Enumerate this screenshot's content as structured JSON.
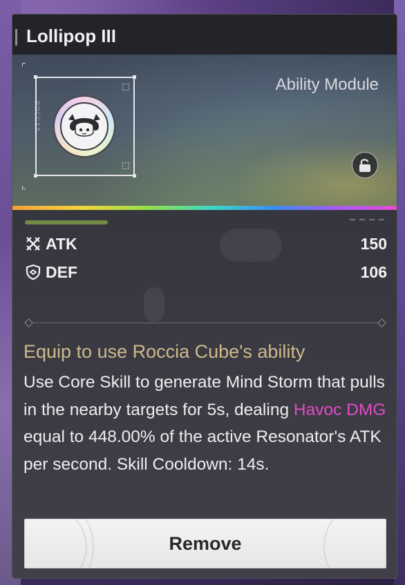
{
  "item": {
    "name": "Lollipop III",
    "type_label": "Ability Module",
    "side_code": "ROCCIA"
  },
  "stats": [
    {
      "name": "ATK",
      "value": "150",
      "icon": "crossed-swords-icon"
    },
    {
      "name": "DEF",
      "value": "106",
      "icon": "shield-icon"
    }
  ],
  "description": {
    "title": "Equip to use Roccia Cube's ability",
    "body_part1": "Use Core Skill to generate Mind Storm that pulls in the nearby targets for 5s, dealing ",
    "highlight": "Havoc DMG",
    "body_part2": " equal to 448.00% of the active Resonator's ATK per second. Skill Cooldown: 14s."
  },
  "actions": {
    "remove_label": "Remove"
  },
  "colors": {
    "title_gold": "#cdbb8c",
    "havoc": "#e24ac8",
    "rank_bar": "#8bae4a"
  },
  "lock_state": "unlocked"
}
